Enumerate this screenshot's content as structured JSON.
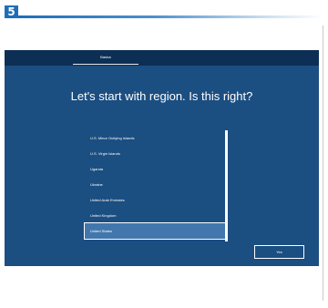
{
  "step": {
    "number": "5"
  },
  "oobe": {
    "tab_label": "Basics",
    "headline": "Let's start with region.  Is this right?",
    "regions": [
      "U.S. Minor Outlying Islands",
      "U.S. Virgin Islands",
      "Uganda",
      "Ukraine",
      "United Arab Emirates",
      "United Kingdom",
      "United States"
    ],
    "selected_region": "United States",
    "yes_label": "Yes"
  },
  "colors": {
    "accent": "#1e6fb8",
    "screen_background": "#1b4e81",
    "top_bar": "#0d2f55",
    "selection": "#4277ad",
    "text": "#ffffff"
  }
}
